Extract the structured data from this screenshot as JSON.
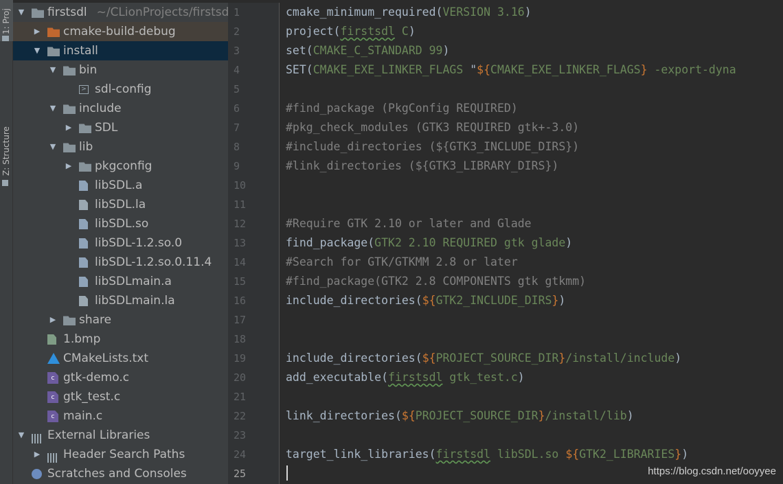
{
  "tool_strip": {
    "project_tab": "1: Proj",
    "structure_tab": "Z: Structure"
  },
  "tree": [
    {
      "label": "firstsdl",
      "hint": "~/CLionProjects/firstsd",
      "indent": 0,
      "arrow": "down",
      "icon": "folder-icon"
    },
    {
      "label": "cmake-build-debug",
      "indent": 1,
      "arrow": "right",
      "icon": "folder-orange-icon",
      "state": "highlight"
    },
    {
      "label": "install",
      "indent": 1,
      "arrow": "down",
      "icon": "folder-icon",
      "state": "selected"
    },
    {
      "label": "bin",
      "indent": 2,
      "arrow": "down",
      "icon": "folder-icon"
    },
    {
      "label": "sdl-config",
      "indent": 3,
      "arrow": "",
      "icon": "script-file-icon"
    },
    {
      "label": "include",
      "indent": 2,
      "arrow": "down",
      "icon": "folder-icon"
    },
    {
      "label": "SDL",
      "indent": 3,
      "arrow": "right",
      "icon": "folder-icon"
    },
    {
      "label": "lib",
      "indent": 2,
      "arrow": "down",
      "icon": "folder-icon"
    },
    {
      "label": "pkgconfig",
      "indent": 3,
      "arrow": "right",
      "icon": "folder-icon"
    },
    {
      "label": "libSDL.a",
      "indent": 3,
      "arrow": "",
      "icon": "unknown-file-icon"
    },
    {
      "label": "libSDL.la",
      "indent": 3,
      "arrow": "",
      "icon": "text-file-icon"
    },
    {
      "label": "libSDL.so",
      "indent": 3,
      "arrow": "",
      "icon": "unknown-file-icon"
    },
    {
      "label": "libSDL-1.2.so.0",
      "indent": 3,
      "arrow": "",
      "icon": "unknown-file-icon"
    },
    {
      "label": "libSDL-1.2.so.0.11.4",
      "indent": 3,
      "arrow": "",
      "icon": "unknown-file-icon"
    },
    {
      "label": "libSDLmain.a",
      "indent": 3,
      "arrow": "",
      "icon": "unknown-file-icon"
    },
    {
      "label": "libSDLmain.la",
      "indent": 3,
      "arrow": "",
      "icon": "text-file-icon"
    },
    {
      "label": "share",
      "indent": 2,
      "arrow": "right",
      "icon": "folder-icon"
    },
    {
      "label": "1.bmp",
      "indent": 1,
      "arrow": "",
      "icon": "image-file-icon"
    },
    {
      "label": "CMakeLists.txt",
      "indent": 1,
      "arrow": "",
      "icon": "cmake-icon"
    },
    {
      "label": "gtk-demo.c",
      "indent": 1,
      "arrow": "",
      "icon": "c-file-icon"
    },
    {
      "label": "gtk_test.c",
      "indent": 1,
      "arrow": "",
      "icon": "c-file-icon"
    },
    {
      "label": "main.c",
      "indent": 1,
      "arrow": "",
      "icon": "c-file-icon"
    },
    {
      "label": "External Libraries",
      "indent": 0,
      "arrow": "down",
      "icon": "libraries-icon"
    },
    {
      "label": "Header Search Paths",
      "indent": 1,
      "arrow": "right",
      "icon": "libraries-icon"
    },
    {
      "label": "Scratches and Consoles",
      "indent": 0,
      "arrow": "",
      "icon": "scratches-icon"
    }
  ],
  "editor": {
    "current_line": 25,
    "line_numbers": [
      "1",
      "2",
      "3",
      "4",
      "5",
      "6",
      "7",
      "8",
      "9",
      "10",
      "11",
      "12",
      "13",
      "14",
      "15",
      "16",
      "17",
      "18",
      "19",
      "20",
      "21",
      "22",
      "23",
      "24",
      "25"
    ],
    "lines": [
      [
        [
          "plain",
          "cmake_minimum_required("
        ],
        [
          "arg",
          "VERSION 3.16"
        ],
        [
          "plain",
          ")"
        ]
      ],
      [
        [
          "plain",
          "project("
        ],
        [
          "ul",
          "firstsdl"
        ],
        [
          "arg",
          " C"
        ],
        [
          "plain",
          ")"
        ]
      ],
      [
        [
          "plain",
          "set("
        ],
        [
          "arg",
          "CMAKE_C_STANDARD 99"
        ],
        [
          "plain",
          ")"
        ]
      ],
      [
        [
          "plain",
          "SET("
        ],
        [
          "arg",
          "CMAKE_EXE_LINKER_FLAGS "
        ],
        [
          "str",
          "\""
        ],
        [
          "var",
          "${"
        ],
        [
          "arg",
          "CMAKE_EXE_LINKER_FLAGS"
        ],
        [
          "var",
          "}"
        ],
        [
          "arg",
          " -export-dyna"
        ]
      ],
      [],
      [
        [
          "comment",
          "#find_package (PkgConfig REQUIRED)"
        ]
      ],
      [
        [
          "comment",
          "#pkg_check_modules (GTK3 REQUIRED gtk+-3.0)"
        ]
      ],
      [
        [
          "comment",
          "#include_directories (${GTK3_INCLUDE_DIRS})"
        ]
      ],
      [
        [
          "comment",
          "#link_directories (${GTK3_LIBRARY_DIRS})"
        ]
      ],
      [],
      [],
      [
        [
          "comment",
          "#Require GTK 2.10 or later and Glade"
        ]
      ],
      [
        [
          "plain",
          "find_package("
        ],
        [
          "arg",
          "GTK2 2.10 REQUIRED gtk glade"
        ],
        [
          "plain",
          ")"
        ]
      ],
      [
        [
          "comment",
          "#Search for GTK/GTKMM 2.8 or later"
        ]
      ],
      [
        [
          "comment",
          "#find_package(GTK2 2.8 COMPONENTS gtk gtkmm)"
        ]
      ],
      [
        [
          "plain",
          "include_directories("
        ],
        [
          "var",
          "${"
        ],
        [
          "arg",
          "GTK2_INCLUDE_DIRS"
        ],
        [
          "var",
          "}"
        ],
        [
          "plain",
          ")"
        ]
      ],
      [],
      [],
      [
        [
          "plain",
          "include_directories("
        ],
        [
          "var",
          "${"
        ],
        [
          "arg",
          "PROJECT_SOURCE_DIR"
        ],
        [
          "var",
          "}"
        ],
        [
          "arg",
          "/install/include"
        ],
        [
          "plain",
          ")"
        ]
      ],
      [
        [
          "plain",
          "add_executable("
        ],
        [
          "ul",
          "firstsdl"
        ],
        [
          "arg",
          " gtk_test.c"
        ],
        [
          "plain",
          ")"
        ]
      ],
      [],
      [
        [
          "plain",
          "link_directories("
        ],
        [
          "var",
          "${"
        ],
        [
          "arg",
          "PROJECT_SOURCE_DIR"
        ],
        [
          "var",
          "}"
        ],
        [
          "arg",
          "/install/lib"
        ],
        [
          "plain",
          ")"
        ]
      ],
      [],
      [
        [
          "plain",
          "target_link_libraries("
        ],
        [
          "ul",
          "firstsdl"
        ],
        [
          "arg",
          " libSDL.so "
        ],
        [
          "var",
          "${"
        ],
        [
          "arg",
          "GTK2_LIBRARIES"
        ],
        [
          "var",
          "}"
        ],
        [
          "plain",
          ")"
        ]
      ],
      []
    ]
  },
  "watermark": "https://blog.csdn.net/ooyyee",
  "colors": {
    "background": "#2b2b2b",
    "panel": "#3c3f41",
    "selection": "#0d293e",
    "keyword_var": "#cc7832",
    "argument": "#6a8759",
    "comment": "#808080"
  }
}
